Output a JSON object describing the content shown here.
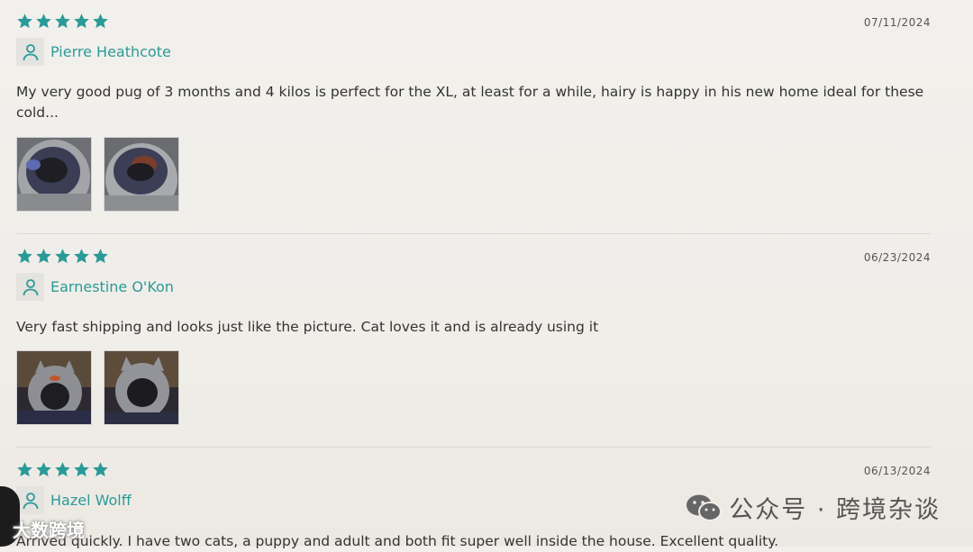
{
  "reviews": [
    {
      "date": "07/11/2024",
      "author": "Pierre Heathcote",
      "rating": 5,
      "text": "My very good pug of 3 months and 4 kilos is perfect for the XL, at least for a while, hairy is happy in his new home ideal for these cold...",
      "photos": 2
    },
    {
      "date": "06/23/2024",
      "author": "Earnestine O'Kon",
      "rating": 5,
      "text": "Very fast shipping and looks just like the picture. Cat loves it and is already using it",
      "photos": 2
    },
    {
      "date": "06/13/2024",
      "author": "Hazel Wolff",
      "rating": 5,
      "text": "Arrived quickly. I have two cats, a puppy and adult and both fit super well inside the house. Excellent quality."
    }
  ],
  "watermark": {
    "right": "公众号 · 跨境杂谈",
    "left": "大数跨境"
  },
  "colors": {
    "accent": "#2a9a98",
    "star": "#2a9a98"
  },
  "icons": {
    "star": "star-icon",
    "avatar": "user-icon",
    "wechat": "wechat-icon"
  }
}
